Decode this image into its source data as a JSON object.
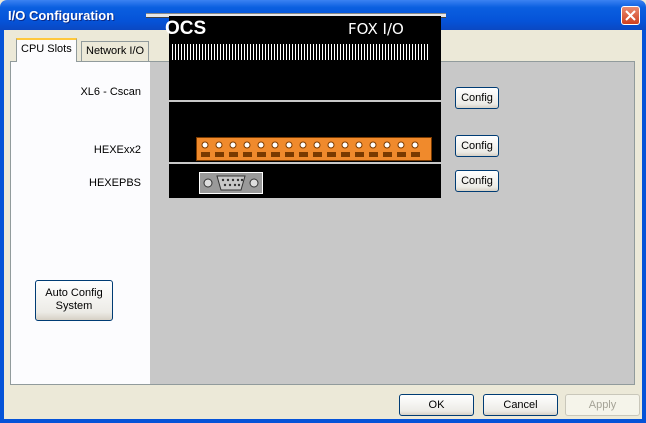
{
  "window": {
    "title": "I/O Configuration"
  },
  "tabs": [
    {
      "label": "CPU Slots",
      "active": true
    },
    {
      "label": "Network I/O",
      "active": false
    }
  ],
  "slots": [
    {
      "label": "XL6 - Cscan",
      "button": "Config"
    },
    {
      "label": "HEXExx2",
      "button": "Config"
    },
    {
      "label": "HEXEPBS",
      "button": "Config"
    }
  ],
  "device": {
    "brand": "OCS",
    "model": "FOX I/O"
  },
  "auto_config": {
    "label_line1": "Auto Config",
    "label_line2": "System"
  },
  "footer": {
    "ok": "OK",
    "cancel": "Cancel",
    "apply": "Apply"
  },
  "colors": {
    "titlebar": "#0553d8",
    "panel_bg": "#c8c8c8",
    "terminal_orange": "#f08a2c",
    "close_red": "#d0401f"
  },
  "icons": {
    "close": "close-icon",
    "serial_port": "db9-port-icon",
    "terminal_block": "terminal-block-icon"
  }
}
